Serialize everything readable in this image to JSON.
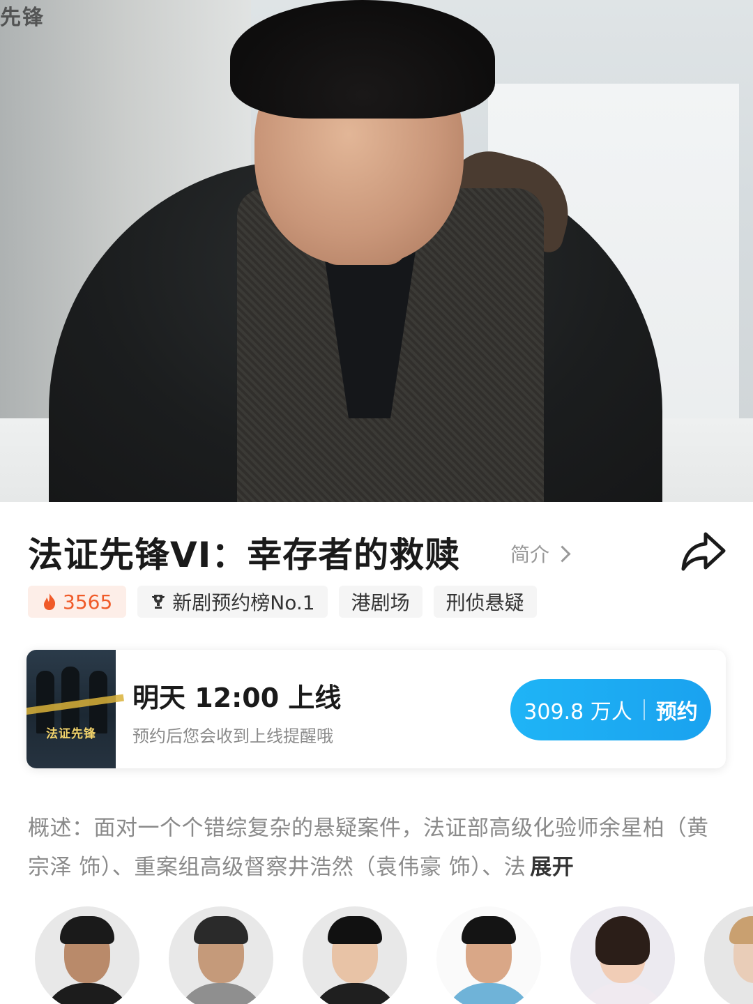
{
  "hero": {
    "logo_text": "先锋"
  },
  "header": {
    "title": "法证先锋VI：幸存者的救赎",
    "intro_label": "简介",
    "share_icon": "share-icon"
  },
  "tags": {
    "heat": "3565",
    "ranking": "新剧预约榜No.1",
    "channel": "港剧场",
    "genre": "刑侦悬疑"
  },
  "reserve_card": {
    "poster_title": "法证先锋",
    "time": "明天 12:00 上线",
    "subtitle": "预约后您会收到上线提醒哦",
    "count": "309.8 万人",
    "button_label": "预约"
  },
  "synopsis": {
    "text": "概述：面对一个个错综复杂的悬疑案件，法证部高级化验师余星柏（黄宗泽 饰）、重案组高级督察井浩然（袁伟豪 饰）、法",
    "expand_label": "展开"
  },
  "cast": [
    {
      "id": "cast-1"
    },
    {
      "id": "cast-2"
    },
    {
      "id": "cast-3"
    },
    {
      "id": "cast-4"
    },
    {
      "id": "cast-5"
    },
    {
      "id": "cast-6"
    }
  ],
  "colors": {
    "accent": "#1fb4f6",
    "hot": "#f05a28",
    "tag_bg": "#f5f5f5"
  }
}
